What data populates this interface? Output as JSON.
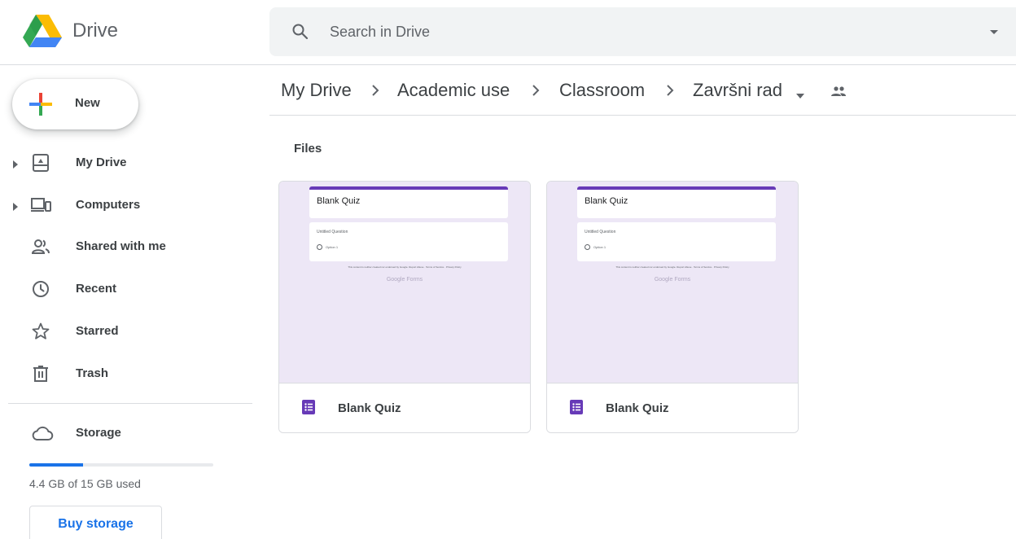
{
  "header": {
    "app_name": "Drive",
    "search": {
      "placeholder": "Search in Drive"
    }
  },
  "sidebar": {
    "new_label": "New",
    "items": [
      {
        "label": "My Drive",
        "icon": "my-drive-icon"
      },
      {
        "label": "Computers",
        "icon": "computers-icon"
      },
      {
        "label": "Shared with me",
        "icon": "shared-with-me-icon"
      },
      {
        "label": "Recent",
        "icon": "clock-icon"
      },
      {
        "label": "Starred",
        "icon": "star-icon"
      },
      {
        "label": "Trash",
        "icon": "trash-icon"
      }
    ],
    "storage": {
      "label": "Storage",
      "used_text": "4.4 GB of 15 GB used",
      "used_fraction": 0.293,
      "buy_label": "Buy storage"
    }
  },
  "breadcrumb": [
    {
      "label": "My Drive"
    },
    {
      "label": "Academic use"
    },
    {
      "label": "Classroom"
    },
    {
      "label": "Završni rad"
    }
  ],
  "main": {
    "section_title": "Files",
    "files": [
      {
        "name": "Blank Quiz",
        "type": "forms-icon",
        "preview": {
          "title": "Blank Quiz",
          "question": "Untitled Question",
          "option": "Option 1",
          "footer": "This content is neither created nor endorsed by Google. Report Abuse · Terms of Service · Privacy Policy",
          "brand": "Google Forms"
        }
      },
      {
        "name": "Blank Quiz",
        "type": "forms-icon",
        "preview": {
          "title": "Blank Quiz",
          "question": "Untitled Question",
          "option": "Option 1",
          "footer": "This content is neither created nor endorsed by Google. Report Abuse · Terms of Service · Privacy Policy",
          "brand": "Google Forms"
        }
      }
    ]
  },
  "colors": {
    "accent": "#1a73e8",
    "forms_purple": "#673ab7",
    "thumb_bg": "#ede7f6"
  }
}
